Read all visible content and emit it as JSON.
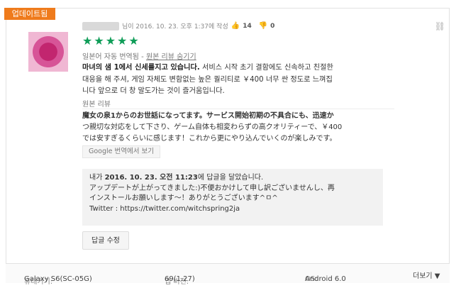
{
  "badge": "업데이트됨",
  "author": {
    "meta_text": "님이 2016. 10. 23. 오후 1:37에 작성",
    "thumbs_up_count": "14",
    "thumbs_down_count": "0"
  },
  "rating": {
    "stars": 5,
    "stars_text": "★★★★★"
  },
  "translation": {
    "note": "일본어 자동 번역됨 - ",
    "show_original_link": "원본 리뷰 숨기기"
  },
  "review": {
    "title": "마녀의 샘 1에서 신세를지고 있습니다.",
    "body_line1": " 서비스 시작 초기 결함에도 신속하고 친절한",
    "body_line2": "대응을 해 주셔, 게임 자체도 변함없는 높은 퀄리티로 ￥400 너무 싼 정도로 느껴집",
    "body_line3": "니다 앞으로 더 창 말도가는 것이 즐거움입니다."
  },
  "original": {
    "label": "원본 리뷰",
    "line1": "魔女の泉1からのお世話になってます。サービス開始初期の不具合にも、迅速か",
    "line2": "つ親切な対応をして下さり、ゲーム自体も相変わらずの高クオリティーで、￥400",
    "line3": "では安すぎるくらいに感じます！これから更にやり込んでいくのが楽しみです。"
  },
  "google_translate_button": "Google 번역에서 보기",
  "reply": {
    "prefix": "내가 ",
    "date": "2016. 10. 23. 오전 11:23",
    "suffix": "에 답글을 달았습니다.",
    "line1": "アップデートが上がってきました:)不便おかけして申し訳ございませんし、再",
    "line2": "インストールお願いします～！ありがとうございます^ㅁ^",
    "line3": "Twitter : https://twitter.com/witchspring2ja"
  },
  "edit_reply_button": "답글 수정",
  "footer": {
    "device_label": "휴대기기:",
    "device_value": "Galaxy S6(SC-05G)",
    "app_version_label": "앱 버전:",
    "app_version_value": "69(1.27)",
    "os_label": "OS:",
    "os_value": "Android 6.0",
    "more_label": "더보기 ▼"
  },
  "colors": {
    "badge": "#ef7b1c",
    "stars": "#0f9d58",
    "reply_bg": "#f2f2f2"
  },
  "icons": [
    "thumbs-up-icon",
    "thumbs-down-icon",
    "link-icon",
    "avatar"
  ]
}
